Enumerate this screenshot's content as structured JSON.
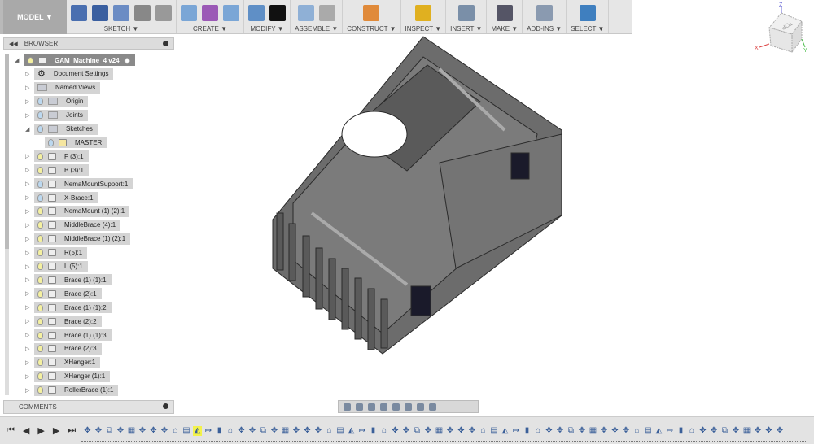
{
  "toolbar": {
    "workspace": "MODEL ▼",
    "groups": [
      {
        "label": "SKETCH ▼",
        "icons": [
          "create-sketch",
          "spline",
          "rectangle",
          "fillet",
          "dimension"
        ]
      },
      {
        "label": "CREATE ▼",
        "icons": [
          "extrude",
          "form",
          "revolve"
        ]
      },
      {
        "label": "MODIFY ▼",
        "icons": [
          "press-pull",
          "sigma"
        ]
      },
      {
        "label": "ASSEMBLE ▼",
        "icons": [
          "new-component",
          "joint"
        ]
      },
      {
        "label": "CONSTRUCT ▼",
        "icons": [
          "offset-plane"
        ]
      },
      {
        "label": "INSPECT ▼",
        "icons": [
          "measure"
        ]
      },
      {
        "label": "INSERT ▼",
        "icons": [
          "insert-image"
        ]
      },
      {
        "label": "MAKE ▼",
        "icons": [
          "3d-print"
        ]
      },
      {
        "label": "ADD-INS ▼",
        "icons": [
          "scripts"
        ]
      },
      {
        "label": "SELECT ▼",
        "icons": [
          "select"
        ]
      }
    ],
    "colors": {
      "select": "#3f7fbf",
      "sketch": "#3a5fa0"
    }
  },
  "viewcube": {
    "face": "TOP",
    "x": "X",
    "y": "Y",
    "z": "Z"
  },
  "browser": {
    "title": "BROWSER",
    "items": [
      {
        "label": "GAM_Machine_4 v24",
        "level": 0,
        "type": "root",
        "expanded": true
      },
      {
        "label": "Document Settings",
        "level": 1,
        "type": "gear"
      },
      {
        "label": "Named Views",
        "level": 1,
        "type": "folder"
      },
      {
        "label": "Origin",
        "level": 1,
        "type": "folder",
        "bulb": "blue"
      },
      {
        "label": "Joints",
        "level": 1,
        "type": "folder",
        "bulb": "blue"
      },
      {
        "label": "Sketches",
        "level": 1,
        "type": "folder",
        "bulb": "blue",
        "expanded": true
      },
      {
        "label": "MASTER",
        "level": 2,
        "type": "sketch",
        "bulb": "blue"
      },
      {
        "label": "F (3):1",
        "level": 1,
        "type": "body",
        "bulb": "yellow"
      },
      {
        "label": "B (3):1",
        "level": 1,
        "type": "body",
        "bulb": "yellow"
      },
      {
        "label": "NemaMountSupport:1",
        "level": 1,
        "type": "body",
        "bulb": "blue"
      },
      {
        "label": "X-Brace:1",
        "level": 1,
        "type": "body",
        "bulb": "blue"
      },
      {
        "label": "NemaMount (1) (2):1",
        "level": 1,
        "type": "body",
        "bulb": "yellow"
      },
      {
        "label": "MiddleBrace (4):1",
        "level": 1,
        "type": "body",
        "bulb": "yellow"
      },
      {
        "label": "MiddleBrace (1) (2):1",
        "level": 1,
        "type": "body",
        "bulb": "yellow"
      },
      {
        "label": "R(5):1",
        "level": 1,
        "type": "body",
        "bulb": "yellow"
      },
      {
        "label": "L (5):1",
        "level": 1,
        "type": "body",
        "bulb": "yellow"
      },
      {
        "label": "Brace (1) (1):1",
        "level": 1,
        "type": "body",
        "bulb": "yellow"
      },
      {
        "label": "Brace (2):1",
        "level": 1,
        "type": "body",
        "bulb": "yellow"
      },
      {
        "label": "Brace (1) (1):2",
        "level": 1,
        "type": "body",
        "bulb": "yellow"
      },
      {
        "label": "Brace (2):2",
        "level": 1,
        "type": "body",
        "bulb": "yellow"
      },
      {
        "label": "Brace (1) (1):3",
        "level": 1,
        "type": "body",
        "bulb": "yellow"
      },
      {
        "label": "Brace (2):3",
        "level": 1,
        "type": "body",
        "bulb": "yellow"
      },
      {
        "label": "XHanger:1",
        "level": 1,
        "type": "body",
        "bulb": "yellow"
      },
      {
        "label": "XHanger (1):1",
        "level": 1,
        "type": "body",
        "bulb": "yellow"
      },
      {
        "label": "RollerBrace (1):1",
        "level": 1,
        "type": "body",
        "bulb": "yellow"
      }
    ]
  },
  "comments": {
    "title": "COMMENTS"
  },
  "timeline": {
    "controls": [
      "⏮",
      "◀",
      "▶",
      "▶",
      "⏭"
    ],
    "feature_count": 64,
    "highlighted_index": 10
  }
}
